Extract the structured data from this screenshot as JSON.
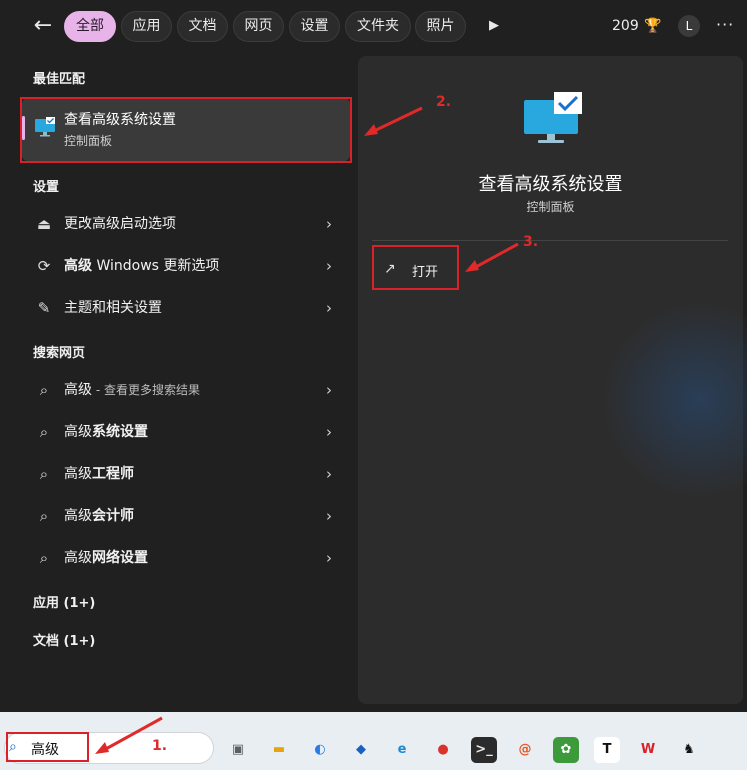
{
  "filters": {
    "back_icon": "back-arrow-icon",
    "tabs": [
      {
        "label": "全部",
        "active": true
      },
      {
        "label": "应用"
      },
      {
        "label": "文档"
      },
      {
        "label": "网页"
      },
      {
        "label": "设置"
      },
      {
        "label": "文件夹"
      },
      {
        "label": "照片"
      }
    ],
    "points": "209",
    "avatar": "L",
    "more": "···"
  },
  "left": {
    "best_match_heading": "最佳匹配",
    "best_match": {
      "title": "查看高级系统设置",
      "subtitle": "控制面板"
    },
    "settings_heading": "设置",
    "settings": [
      {
        "label": "更改高级启动选项"
      },
      {
        "prefix": "高级",
        "label": " Windows 更新选项"
      },
      {
        "label": "主题和相关设置"
      }
    ],
    "web_heading": "搜索网页",
    "web": [
      {
        "bold": "高级",
        "sub": " - 查看更多搜索结果"
      },
      {
        "bold": "高级",
        "rest": "系统设置"
      },
      {
        "bold": "高级",
        "rest": "工程师"
      },
      {
        "bold": "高级",
        "rest": "会计师"
      },
      {
        "bold": "高级",
        "rest": "网络设置"
      }
    ],
    "apps": "应用 (1+)",
    "docs": "文档 (1+)"
  },
  "right": {
    "title": "查看高级系统设置",
    "subtitle": "控制面板",
    "open_label": "打开"
  },
  "annotations": {
    "step1": "1.",
    "step2": "2.",
    "step3": "3."
  },
  "taskbar": {
    "search_text": "高级",
    "apps": [
      {
        "name": "task-view-icon",
        "glyph": "▣",
        "color": "#5a5f66",
        "bg": "#e9eef2"
      },
      {
        "name": "file-explorer-icon",
        "glyph": "▬",
        "color": "#e8a20c",
        "bg": "#e9eef2"
      },
      {
        "name": "browser-circle-icon",
        "glyph": "◐",
        "color": "#2a7be4",
        "bg": "#e9eef2"
      },
      {
        "name": "store-icon",
        "glyph": "◆",
        "color": "#1b5fbf",
        "bg": "#e9eef2"
      },
      {
        "name": "edge-icon",
        "glyph": "e",
        "color": "#1f8ad4",
        "bg": "#e9eef2"
      },
      {
        "name": "chrome-icon",
        "glyph": "●",
        "color": "#d9342b",
        "bg": "#e9eef2"
      },
      {
        "name": "terminal-icon",
        "glyph": ">_",
        "color": "#e8e8e8",
        "bg": "#2b2b2b"
      },
      {
        "name": "spiral-app-icon",
        "glyph": "@",
        "color": "#e05a2b",
        "bg": "#e9eef2"
      },
      {
        "name": "green-app-icon",
        "glyph": "✿",
        "color": "#ffffff",
        "bg": "#3c9a3a"
      },
      {
        "name": "typora-icon",
        "glyph": "T",
        "color": "#111111",
        "bg": "#ffffff"
      },
      {
        "name": "wps-icon",
        "glyph": "W",
        "color": "#d9212a",
        "bg": "#e9eef2"
      },
      {
        "name": "alpaca-app-icon",
        "glyph": "♞",
        "color": "#111111",
        "bg": "#e9eef2"
      }
    ]
  }
}
